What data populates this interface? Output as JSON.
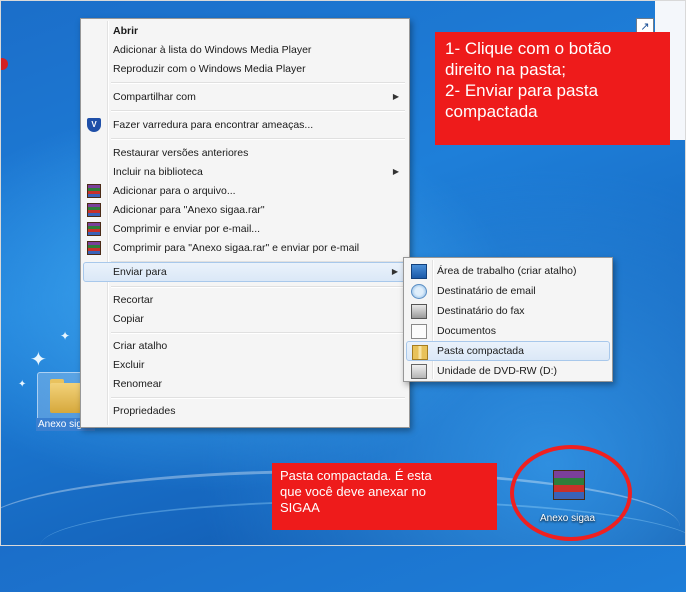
{
  "context_menu": {
    "items": [
      {
        "label": "Abrir",
        "bold": true
      },
      {
        "label": "Adicionar à lista do Windows Media Player"
      },
      {
        "label": "Reproduzir com o Windows Media Player"
      },
      {
        "label": "Compartilhar com",
        "submenu": true
      },
      {
        "label": "Fazer varredura para encontrar ameaças...",
        "icon": "antivirus-shield-icon"
      },
      {
        "label": "Restaurar versões anteriores"
      },
      {
        "label": "Incluir na biblioteca",
        "submenu": true
      },
      {
        "label": "Adicionar para o arquivo...",
        "icon": "winrar-icon"
      },
      {
        "label": "Adicionar para \"Anexo sigaa.rar\"",
        "icon": "winrar-icon"
      },
      {
        "label": "Comprimir e enviar por e-mail...",
        "icon": "winrar-icon"
      },
      {
        "label": "Comprimir para \"Anexo sigaa.rar\" e enviar por e-mail",
        "icon": "winrar-icon"
      },
      {
        "label": "Enviar para",
        "submenu": true,
        "highlighted": true
      },
      {
        "label": "Recortar"
      },
      {
        "label": "Copiar"
      },
      {
        "label": "Criar atalho"
      },
      {
        "label": "Excluir"
      },
      {
        "label": "Renomear"
      },
      {
        "label": "Propriedades"
      }
    ]
  },
  "send_to_menu": {
    "items": [
      {
        "label": "Área de trabalho (criar atalho)",
        "icon": "desktop-icon"
      },
      {
        "label": "Destinatário de email",
        "icon": "mail-icon"
      },
      {
        "label": "Destinatário do fax",
        "icon": "fax-icon"
      },
      {
        "label": "Documentos",
        "icon": "documents-icon"
      },
      {
        "label": "Pasta compactada",
        "icon": "zip-folder-icon",
        "highlighted": true
      },
      {
        "label": "Unidade de DVD-RW (D:)",
        "icon": "dvd-drive-icon"
      }
    ]
  },
  "callouts": {
    "top": {
      "line1": "1- Clique com o botão",
      "line2": "direito na pasta;",
      "line3": "2- Enviar para pasta",
      "line4": "compactada"
    },
    "bottom": {
      "line1": "Pasta compactada. É esta",
      "line2": "que você deve anexar no",
      "line3": "SIGAA"
    }
  },
  "desktop": {
    "folder_label": "Anexo sigaa",
    "archive_label": "Anexo sigaa"
  },
  "colors": {
    "callout_red": "#ee1b1b",
    "menu_highlight": "#dbe8f7",
    "desktop_blue": "#1e7fd9"
  }
}
